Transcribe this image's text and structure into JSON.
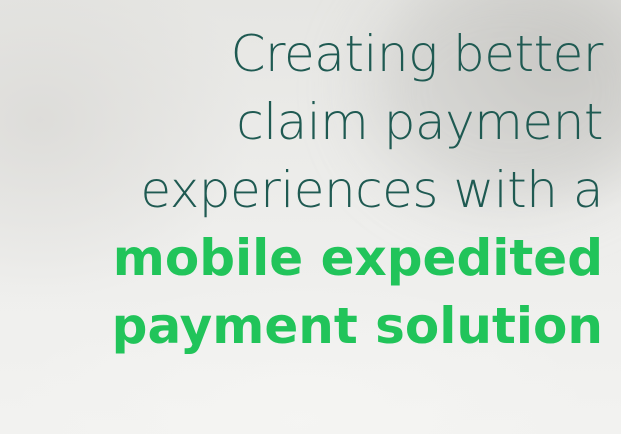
{
  "hero": {
    "headline_lines": [
      {
        "text": "Creating better",
        "style": "light"
      },
      {
        "text": "claim payment",
        "style": "light"
      },
      {
        "text": "experiences with a",
        "style": "light"
      },
      {
        "text": "mobile expedited",
        "style": "bold"
      },
      {
        "text": "payment solution",
        "style": "bold"
      }
    ],
    "colors": {
      "headline_dark": "#1f5a52",
      "headline_accent": "#21c45a"
    }
  }
}
